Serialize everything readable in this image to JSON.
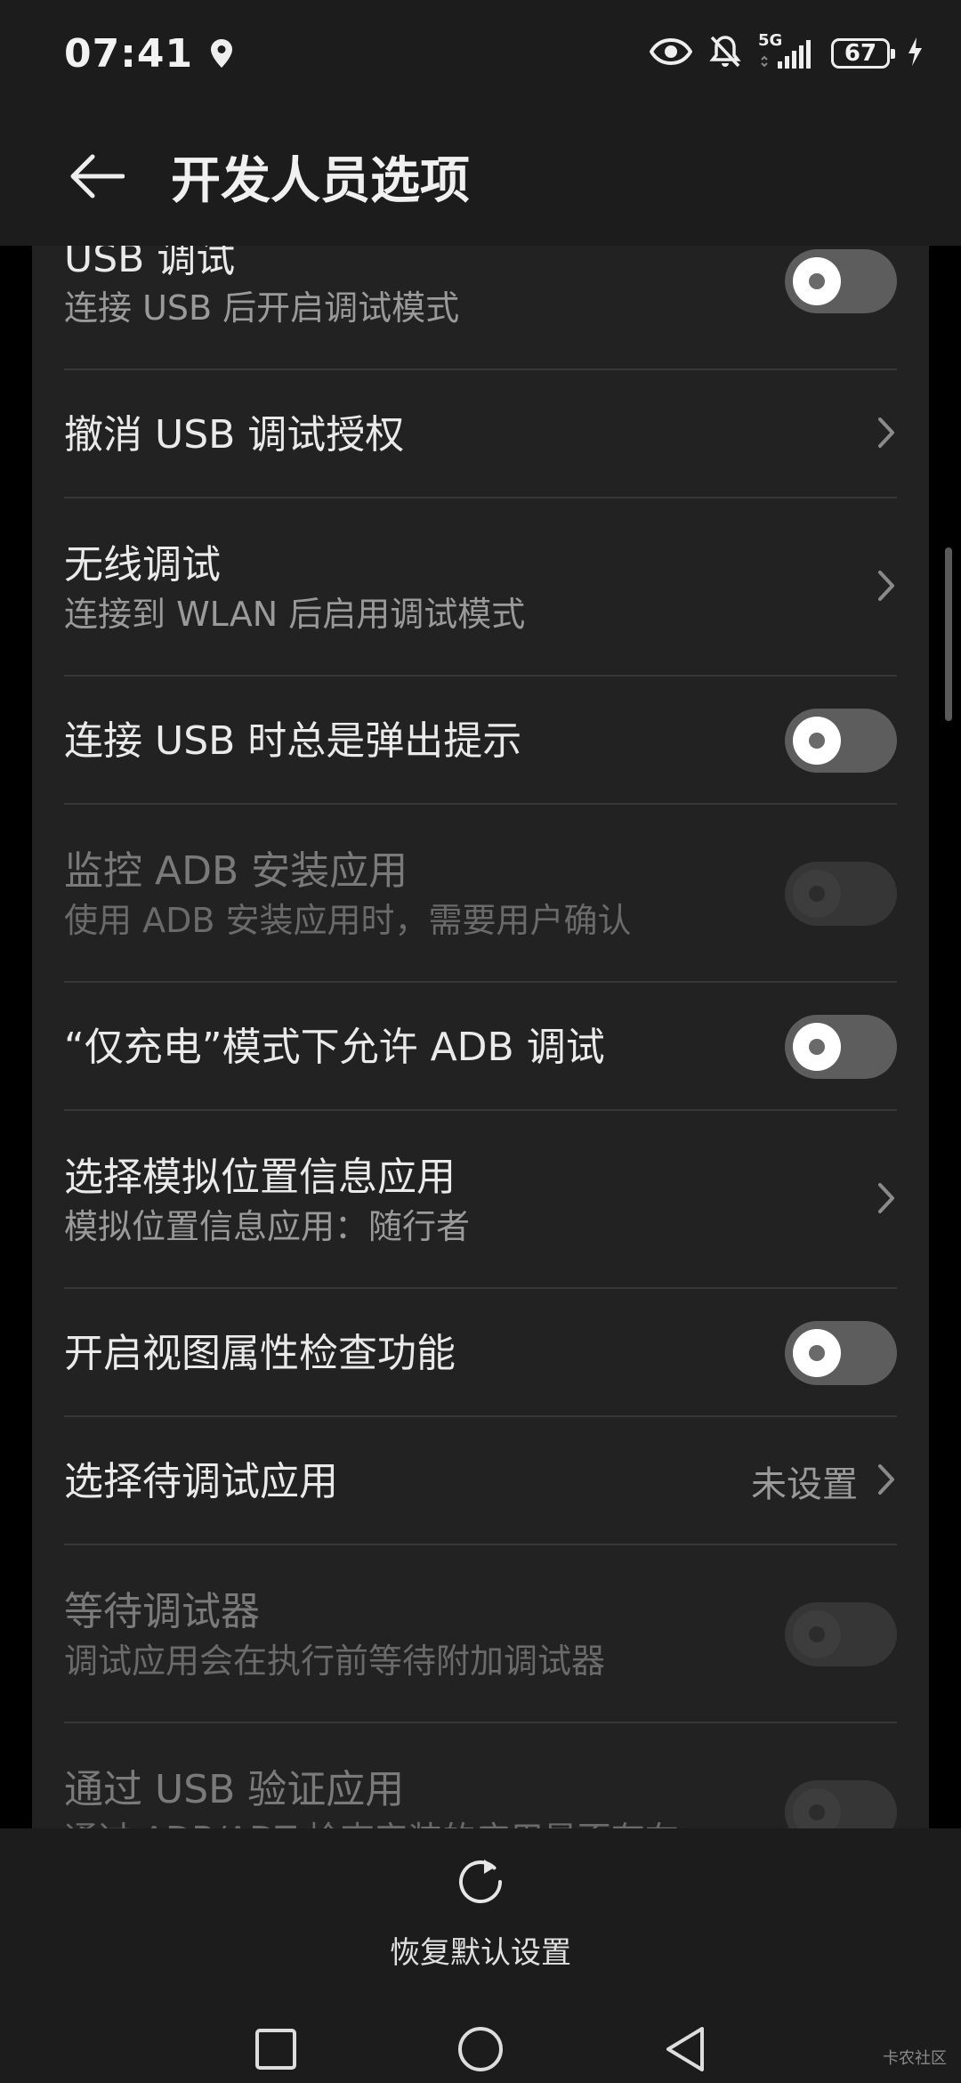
{
  "status_bar": {
    "time": "07:41",
    "network": "5G",
    "battery": "67",
    "icons": [
      "location-icon",
      "eye-icon",
      "bell-off-icon",
      "signal-icon",
      "battery-icon",
      "charging-icon"
    ]
  },
  "header": {
    "title": "开发人员选项"
  },
  "settings": [
    {
      "title": "USB 调试",
      "subtitle": "连接 USB 后开启调试模式",
      "control": "toggle",
      "on": false,
      "disabled": false
    },
    {
      "title": "撤消 USB 调试授权",
      "subtitle": "",
      "control": "chevron",
      "disabled": false
    },
    {
      "title": "无线调试",
      "subtitle": "连接到 WLAN 后启用调试模式",
      "control": "chevron",
      "disabled": false
    },
    {
      "title": "连接 USB 时总是弹出提示",
      "subtitle": "",
      "control": "toggle",
      "on": false,
      "disabled": false
    },
    {
      "title": "监控 ADB 安装应用",
      "subtitle": "使用 ADB 安装应用时，需要用户确认",
      "control": "toggle",
      "on": false,
      "disabled": true
    },
    {
      "title": "“仅充电”模式下允许 ADB 调试",
      "subtitle": "",
      "control": "toggle",
      "on": false,
      "disabled": false
    },
    {
      "title": "选择模拟位置信息应用",
      "subtitle": "模拟位置信息应用：随行者",
      "control": "chevron",
      "disabled": false
    },
    {
      "title": "开启视图属性检查功能",
      "subtitle": "",
      "control": "toggle",
      "on": false,
      "disabled": false
    },
    {
      "title": "选择待调试应用",
      "subtitle": "",
      "value": "未设置",
      "control": "chevron",
      "disabled": false
    },
    {
      "title": "等待调试器",
      "subtitle": "调试应用会在执行前等待附加调试器",
      "control": "toggle",
      "on": false,
      "disabled": true
    },
    {
      "title": "通过 USB 验证应用",
      "subtitle": "通过 ADB/ADT 检查安装的应用是否存在",
      "control": "toggle",
      "on": false,
      "disabled": true
    }
  ],
  "bottom": {
    "reset_label": "恢复默认设置"
  },
  "nav": {
    "icons": [
      "recents-icon",
      "home-icon",
      "back-icon"
    ]
  },
  "watermark": "卡农社区",
  "colors": {
    "background": "#000000",
    "card": "#222222",
    "header": "#1c1c1c",
    "toggle_off": "#5d5d5d"
  }
}
